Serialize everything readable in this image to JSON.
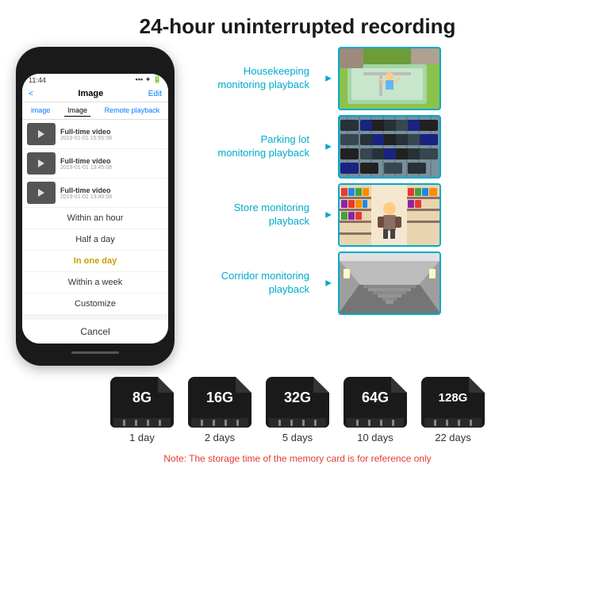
{
  "header": {
    "title": "24-hour uninterrupted recording"
  },
  "phone": {
    "time": "11:44",
    "nav": {
      "back": "<",
      "title": "Image",
      "edit": "Edit"
    },
    "tabs": [
      "image",
      "Image",
      "Remote playback"
    ],
    "videos": [
      {
        "title": "Full-time video",
        "date": "2019-01-01 15:55:08"
      },
      {
        "title": "Full-time video",
        "date": "2019-01-01 13:45:08"
      },
      {
        "title": "Full-time video",
        "date": "2019-01-01 13:40:08"
      }
    ],
    "dropdown": {
      "items": [
        "Within an hour",
        "Half a day",
        "In one day",
        "Within a week",
        "Customize"
      ],
      "selected": "In one day",
      "cancel": "Cancel"
    }
  },
  "monitoring": [
    {
      "label": "Housekeeping\nmonitoring playback",
      "scene": "housekeeping"
    },
    {
      "label": "Parking lot\nmonitoring playback",
      "scene": "parking"
    },
    {
      "label": "Store monitoring\nplayback",
      "scene": "store"
    },
    {
      "label": "Corridor monitoring\nplayback",
      "scene": "corridor"
    }
  ],
  "storage": {
    "cards": [
      {
        "size": "8G",
        "days": "1 day"
      },
      {
        "size": "16G",
        "days": "2 days"
      },
      {
        "size": "32G",
        "days": "5 days"
      },
      {
        "size": "64G",
        "days": "10 days"
      },
      {
        "size": "128G",
        "days": "22 days"
      }
    ],
    "note": "Note: The storage time of the memory card is for reference only"
  }
}
